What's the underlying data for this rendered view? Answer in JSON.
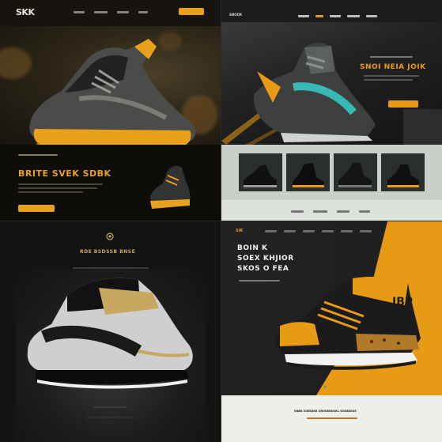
{
  "panels": {
    "q1": {
      "logo": "SKK",
      "cta_label": "",
      "headline": "BRITE SVEK SDBK",
      "colors": {
        "accent": "#e8a11c",
        "bg": "#17140f"
      }
    },
    "q2": {
      "logo": "SNOOK",
      "headline": "SNOI NEIA JOIK",
      "colors": {
        "accent": "#e79a14",
        "teal": "#37c6c2"
      }
    },
    "q3": {
      "headline": "RDE BSDSSB BNSE",
      "colors": {
        "accent": "#c8a760"
      }
    },
    "q4": {
      "logo": "SIK",
      "headline_lines": [
        "BOIN K",
        "SOEX KHJIOR",
        "SKOS O FEA"
      ],
      "bottom_text": "SNBK SOEKBSK SNOSBNOSKL SODBSKSE",
      "colors": {
        "accent": "#e79a14",
        "dark": "#1b1b1b"
      }
    }
  }
}
